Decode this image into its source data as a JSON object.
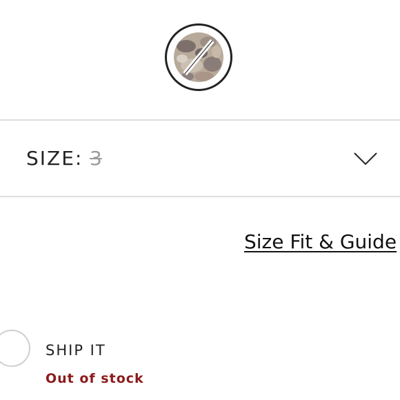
{
  "swatch": {
    "icon": "unavailable-pattern-swatch-icon"
  },
  "size_selector": {
    "label": "SIZE:",
    "value": "3",
    "icon": "chevron-down-icon"
  },
  "size_guide_link": "Size Fit & Guide",
  "shipping": {
    "option_label": "SHIP IT",
    "status": "Out of stock",
    "status_color": "#8b1a1a"
  }
}
